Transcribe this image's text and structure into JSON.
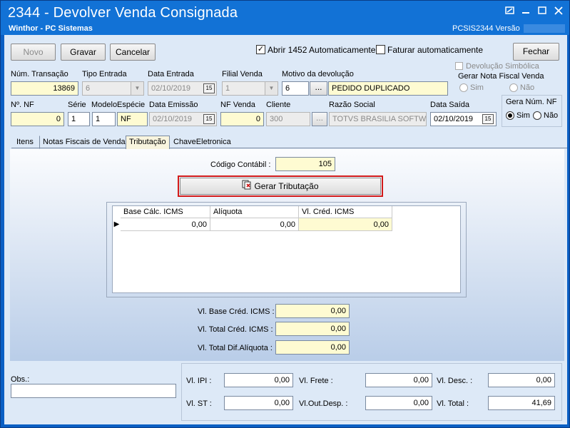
{
  "window": {
    "title": "2344 - Devolver Venda Consignada",
    "subtitle": "Winthor - PC Sistemas",
    "version_label": "PCSIS2344  Versão",
    "min_icon": "minimize-icon",
    "max_icon": "maximize-icon",
    "close_icon": "close-icon"
  },
  "toolbar": {
    "novo": "Novo",
    "gravar": "Gravar",
    "cancelar": "Cancelar",
    "fechar": "Fechar",
    "abrir_1452": "Abrir 1452 Automaticamente",
    "faturar_auto": "Faturar automaticamente",
    "devolucao_simbolica": "Devolução Simbólica",
    "abrir_1452_checked": true,
    "faturar_auto_checked": false
  },
  "row1": {
    "num_transacao_label": "Núm. Transação",
    "num_transacao": "13869",
    "tipo_entrada_label": "Tipo Entrada",
    "tipo_entrada": "6",
    "data_entrada_label": "Data Entrada",
    "data_entrada": "02/10/2019",
    "filial_venda_label": "Filial Venda",
    "filial_venda": "1",
    "motivo_label": "Motivo da devolução",
    "motivo_code": "6",
    "motivo_desc": "PEDIDO DUPLICADO",
    "ellipsis": "...",
    "gerar_nf_label": "Gerar Nota Fiscal Venda",
    "sim": "Sim",
    "nao": "Não"
  },
  "row2": {
    "num_nf_label": "Nº. NF",
    "num_nf": "0",
    "serie_label": "Série",
    "serie": "1",
    "modelo_label": "Modelo",
    "modelo": "1",
    "especie_label": "Espécie",
    "especie": "NF",
    "data_emissao_label": "Data Emissão",
    "data_emissao": "02/10/2019",
    "nf_venda_label": "NF Venda",
    "nf_venda": "0",
    "cliente_label": "Cliente",
    "cliente": "300",
    "razao_social_label": "Razão Social",
    "razao_social": "TOTVS BRASILIA SOFTWAR",
    "data_saida_label": "Data Saída",
    "data_saida": "02/10/2019",
    "gera_num_nf_label": "Gera Núm. NF",
    "sim": "Sim",
    "nao": "Não"
  },
  "tabs": [
    "Itens",
    "Notas Fiscais de Venda",
    "Tributação",
    "ChaveEletronica"
  ],
  "tributacao": {
    "codigo_contabil_label": "Código Contábil :",
    "codigo_contabil": "105",
    "gerar_button": "Gerar Tributação",
    "grid": {
      "columns": [
        "Base Cálc. ICMS",
        "Alíquota",
        "Vl. Créd. ICMS"
      ],
      "rows": [
        [
          "0,00",
          "0,00",
          "0,00"
        ]
      ]
    },
    "vl_base_label": "Vl. Base Créd. ICMS :",
    "vl_base": "0,00",
    "vl_total_cred_label": "Vl. Total Créd. ICMS :",
    "vl_total_cred": "0,00",
    "vl_total_dif_label": "Vl. Total Dif.Alíquota :",
    "vl_total_dif": "0,00"
  },
  "footer": {
    "obs_label": "Obs.:",
    "obs": "",
    "vl_ipi_label": "Vl. IPI :",
    "vl_ipi": "0,00",
    "vl_st_label": "Vl. ST :",
    "vl_st": "0,00",
    "vl_frete_label": "Vl. Frete :",
    "vl_frete": "0,00",
    "vl_out_label": "Vl.Out.Desp. :",
    "vl_out": "0,00",
    "vl_desc_label": "Vl. Desc. :",
    "vl_desc": "0,00",
    "vl_total_label": "Vl. Total :",
    "vl_total": "41,69"
  },
  "colors": {
    "title_bar": "#1272d6",
    "client_bg": "#dde9f7",
    "highlight_field": "#fefbd2",
    "selected_box": "#d21a1a"
  }
}
